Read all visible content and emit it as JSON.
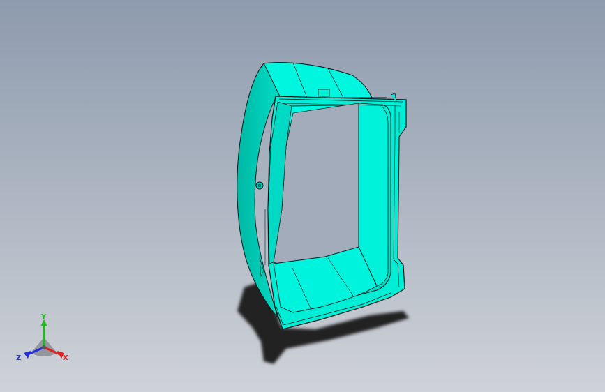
{
  "viewport": {
    "background_top": "#8e9bae",
    "background_bottom": "#cfd2d8"
  },
  "model": {
    "part_color": "#00ffe1",
    "part_shade": "#00c9b4",
    "edge_color": "#0a1a1a",
    "shadow_color": "#1e1e1e"
  },
  "triad": {
    "x_label": "X",
    "y_label": "Y",
    "z_label": "Z",
    "x_color": "#e02020",
    "y_color": "#1fb81f",
    "z_color": "#2030e0"
  }
}
